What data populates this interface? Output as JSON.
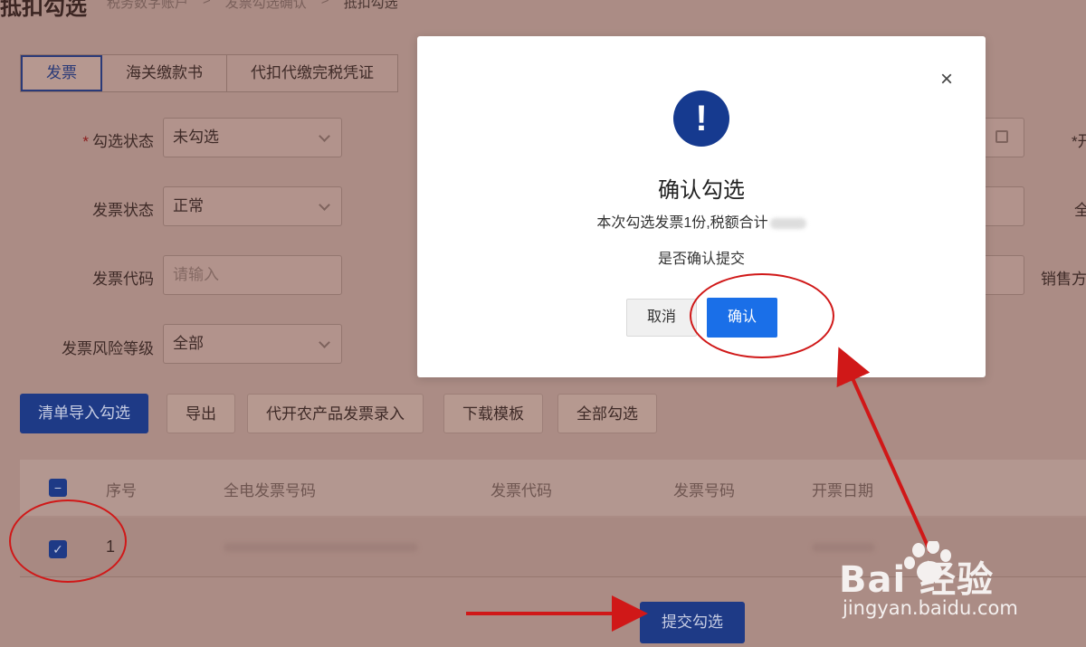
{
  "header": {
    "page_title": "抵扣勾选",
    "breadcrumb": [
      "税务数字账户",
      "发票勾选确认",
      "抵扣勾选"
    ]
  },
  "tabs": [
    {
      "label": "发票",
      "active": true
    },
    {
      "label": "海关缴款书",
      "active": false
    },
    {
      "label": "代扣代缴完税凭证",
      "active": false
    }
  ],
  "form": {
    "check_status_label": "勾选状态",
    "check_status_value": "未勾选",
    "invoice_status_label": "发票状态",
    "invoice_status_value": "正常",
    "invoice_code_label": "发票代码",
    "invoice_code_placeholder": "请输入",
    "risk_level_label": "发票风险等级",
    "risk_level_value": "全部",
    "right_cut_labels": [
      "*开",
      "全",
      "销售方"
    ]
  },
  "actions": [
    {
      "label": "清单导入勾选",
      "primary": true
    },
    {
      "label": "导出",
      "primary": false
    },
    {
      "label": "代开农产品发票录入",
      "primary": false
    },
    {
      "label": "下载模板",
      "primary": false
    },
    {
      "label": "全部勾选",
      "primary": false
    }
  ],
  "table": {
    "columns": [
      "序号",
      "全电发票号码",
      "发票代码",
      "发票号码",
      "开票日期"
    ],
    "rows": [
      {
        "index": "1",
        "checked": true
      }
    ]
  },
  "submit_label": "提交勾选",
  "modal": {
    "title": "确认勾选",
    "desc": "本次勾选发票1份,税额合计",
    "ask": "是否确认提交",
    "cancel_label": "取消",
    "ok_label": "确认",
    "close_symbol": "×",
    "icon_symbol": "!"
  },
  "watermark": {
    "brand": "Bai 经验",
    "url": "jingyan.baidu.com"
  },
  "colors": {
    "primary": "#1e3a86",
    "modal_ok": "#1a6fe8",
    "annotation_red": "#d01818",
    "overlay_bg": "#ab8c85"
  }
}
